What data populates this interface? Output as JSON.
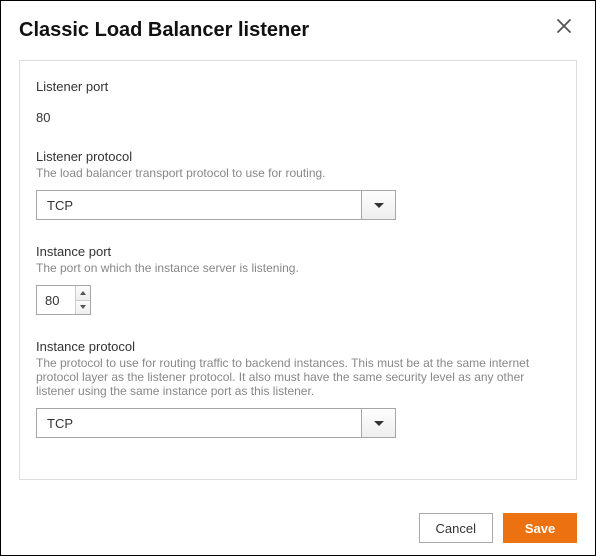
{
  "dialog": {
    "title": "Classic Load Balancer listener"
  },
  "listener_port": {
    "label": "Listener port",
    "value": "80"
  },
  "listener_protocol": {
    "label": "Listener protocol",
    "description": "The load balancer transport protocol to use for routing.",
    "value": "TCP"
  },
  "instance_port": {
    "label": "Instance port",
    "description": "The port on which the instance server is listening.",
    "value": "80"
  },
  "instance_protocol": {
    "label": "Instance protocol",
    "description": "The protocol to use for routing traffic to backend instances. This must be at the same internet protocol layer as the listener protocol. It also must have the same security level as any other listener using the same instance port as this listener.",
    "value": "TCP"
  },
  "buttons": {
    "cancel": "Cancel",
    "save": "Save"
  }
}
